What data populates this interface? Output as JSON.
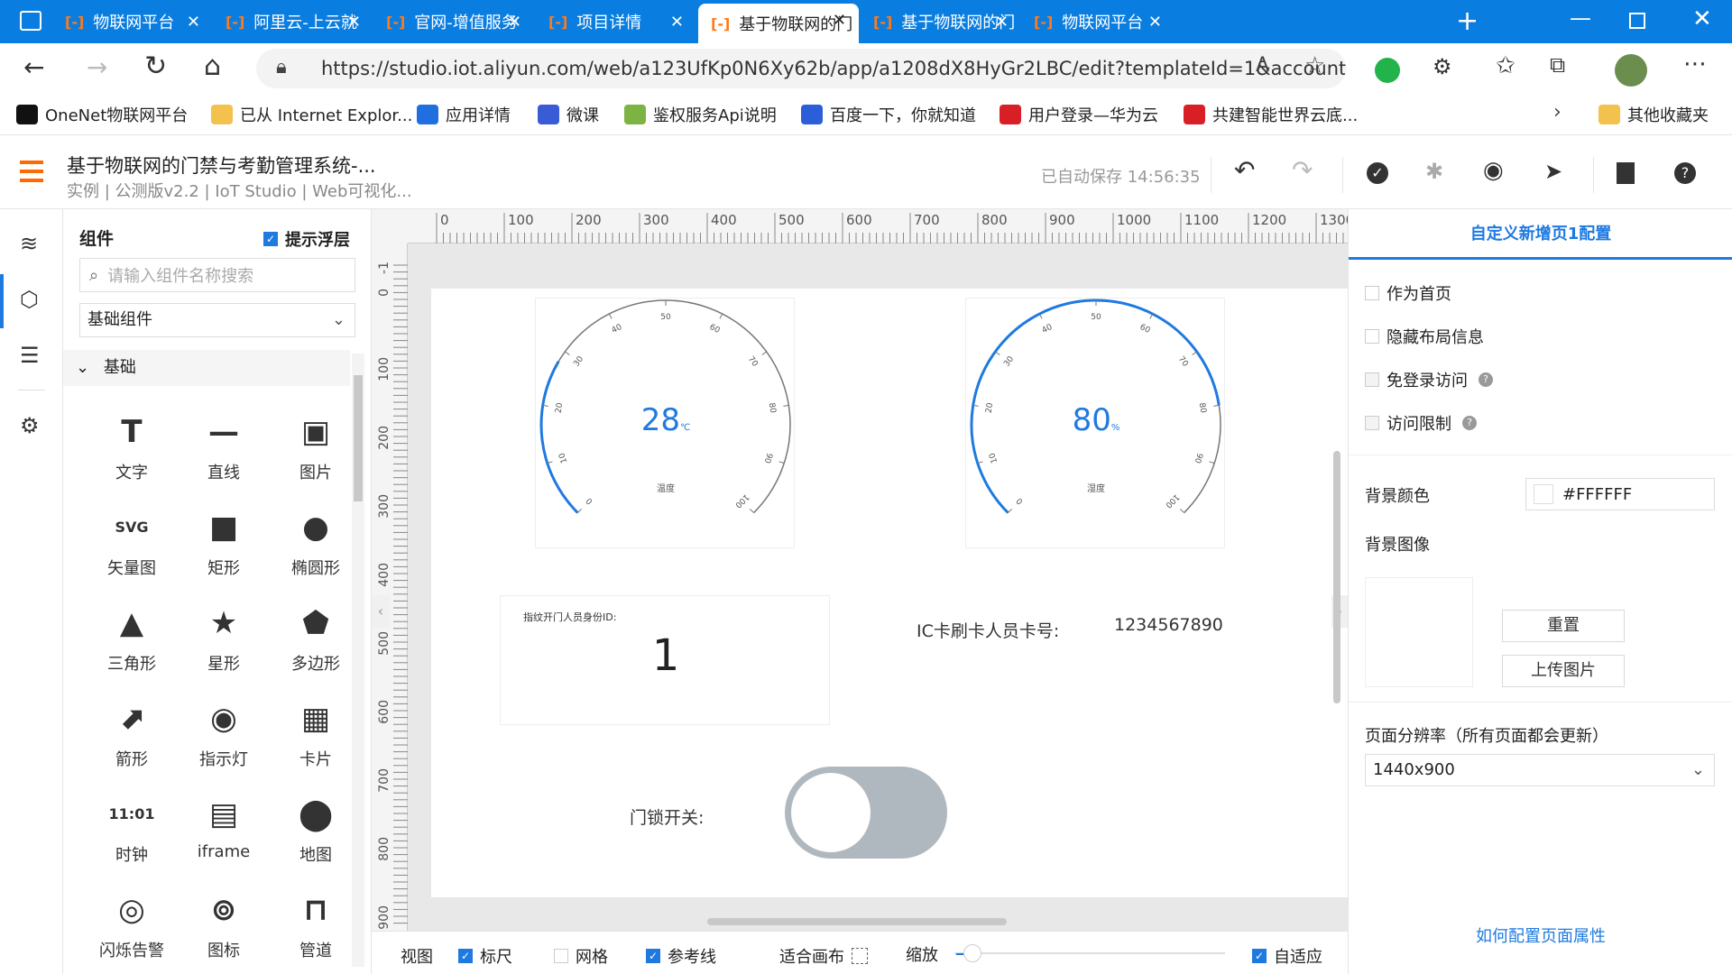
{
  "browser": {
    "tabs": [
      {
        "title": "物联网平台",
        "active": false
      },
      {
        "title": "阿里云-上云就",
        "active": false
      },
      {
        "title": "官网-增值服务",
        "active": false
      },
      {
        "title": "项目详情",
        "active": false
      },
      {
        "title": "基于物联网的门",
        "active": true
      },
      {
        "title": "基于物联网的门",
        "active": false
      },
      {
        "title": "物联网平台",
        "active": false
      }
    ],
    "url": "https://studio.iot.aliyun.com/web/a123UfKp0N6Xy62b/app/a1208dX8HyGr2LBC/edit?templateId=1&account...",
    "bookmarks": [
      {
        "label": "OneNet物联网平台",
        "color": "#111111"
      },
      {
        "label": "已从 Internet Explor...",
        "color": "#f2c14e"
      },
      {
        "label": "应用详情",
        "color": "#1f6fe0"
      },
      {
        "label": "微课",
        "color": "#3a5bd6"
      },
      {
        "label": "鉴权服务Api说明",
        "color": "#7cb342"
      },
      {
        "label": "百度一下，你就知道",
        "color": "#2b5fd9"
      },
      {
        "label": "用户登录—华为云",
        "color": "#d81f26"
      },
      {
        "label": "共建智能世界云底...",
        "color": "#d81f26"
      }
    ],
    "other_bookmarks": "其他收藏夹"
  },
  "app": {
    "title": "基于物联网的门禁与考勤管理系统-...",
    "subtitle": "实例 | 公测版v2.2 | IoT Studio | Web可视化...",
    "autosave": "已自动保存 14:56:35"
  },
  "components_panel": {
    "title": "组件",
    "hint_label": "提示浮层",
    "search_placeholder": "请输入组件名称搜索",
    "category": "基础组件",
    "group": "基础",
    "items": [
      {
        "label": "文字",
        "icon": "T"
      },
      {
        "label": "直线",
        "icon": "—"
      },
      {
        "label": "图片",
        "icon": "▣"
      },
      {
        "label": "矢量图",
        "icon": "SVG"
      },
      {
        "label": "矩形",
        "icon": "■"
      },
      {
        "label": "椭圆形",
        "icon": "●"
      },
      {
        "label": "三角形",
        "icon": "▲"
      },
      {
        "label": "星形",
        "icon": "★"
      },
      {
        "label": "多边形",
        "icon": "⬟"
      },
      {
        "label": "箭形",
        "icon": "⬈"
      },
      {
        "label": "指示灯",
        "icon": "◉"
      },
      {
        "label": "卡片",
        "icon": "▦"
      },
      {
        "label": "时钟",
        "icon": "11:01"
      },
      {
        "label": "iframe",
        "icon": "▤"
      },
      {
        "label": "地图",
        "icon": "⬤"
      },
      {
        "label": "闪烁告警",
        "icon": "◎"
      },
      {
        "label": "图标",
        "icon": "⊚"
      },
      {
        "label": "管道",
        "icon": "⊓"
      }
    ]
  },
  "canvas": {
    "ruler_top": [
      "0",
      "100",
      "200",
      "300",
      "400",
      "500",
      "600",
      "700",
      "800",
      "900",
      "1000",
      "1100",
      "1200",
      "1300"
    ],
    "ruler_left": [
      "-1",
      "0",
      "100",
      "200",
      "300",
      "400",
      "500",
      "600",
      "700",
      "800",
      "900"
    ],
    "gauge1": {
      "value": "28",
      "unit": "℃",
      "label": "温度",
      "level": 0.28,
      "ticks": [
        "0",
        "10",
        "20",
        "30",
        "40",
        "50",
        "60",
        "70",
        "80",
        "90",
        "100"
      ]
    },
    "gauge2": {
      "value": "80",
      "unit": "%",
      "label": "湿度",
      "level": 0.8,
      "ticks": [
        "0",
        "10",
        "20",
        "30",
        "40",
        "50",
        "60",
        "70",
        "80",
        "90",
        "100"
      ]
    },
    "fingerprint_label": "指纹开门人员身份ID:",
    "fingerprint_value": "1",
    "ic_label": "IC卡刷卡人员卡号:",
    "ic_value": "1234567890",
    "lock_label": "门锁开关:"
  },
  "bottom_bar": {
    "view": "视图",
    "ruler": "标尺",
    "grid": "网格",
    "guides": "参考线",
    "fit": "适合画布",
    "zoom": "缩放",
    "auto": "自适应"
  },
  "config_panel": {
    "title": "自定义新增页1配置",
    "home": "作为首页",
    "hide_layout": "隐藏布局信息",
    "no_login": "免登录访问",
    "access_limit": "访问限制",
    "bg_color_label": "背景颜色",
    "bg_color": "#FFFFFF",
    "bg_image_label": "背景图像",
    "reset": "重置",
    "upload": "上传图片",
    "resolution_label": "页面分辨率（所有页面都会更新）",
    "resolution": "1440x900",
    "help_link": "如何配置页面属性"
  }
}
